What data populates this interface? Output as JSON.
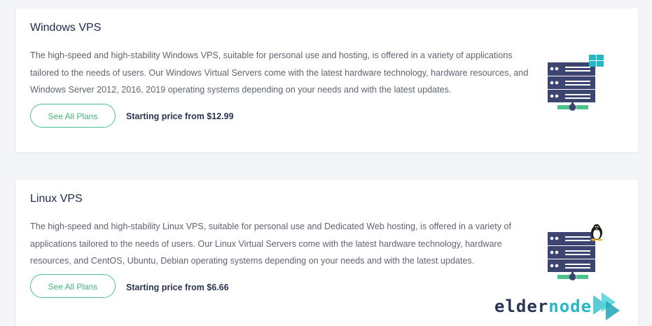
{
  "cards": [
    {
      "title": "Windows VPS",
      "description": "The high-speed and high-stability Windows VPS, suitable for personal use and hosting, is offered in a variety of applications tailored to the needs of users. Our Windows Virtual Servers come with the latest hardware technology, hardware resources, and Windows Server 2012, 2016, 2019 operating systems depending on your needs and with the latest updates.",
      "button_label": "See All Plans",
      "price": "Starting price from $12.99",
      "icon": "windows-server-icon"
    },
    {
      "title": "Linux VPS",
      "description": "The high-speed and high-stability Linux VPS, suitable for personal use and Dedicated Web hosting, is offered in a variety of applications tailored to the needs of users. Our Linux Virtual Servers come with the latest hardware technology, hardware resources, and CentOS, Ubuntu, Debian operating systems depending on your needs and with the latest updates.",
      "button_label": "See All Plans",
      "price": "Starting price from $6.66",
      "icon": "linux-server-icon"
    }
  ],
  "brand": {
    "logo_text": "eldernode",
    "colors": {
      "dark": "#2a3552",
      "accent": "#25b9c6",
      "button_green": "#4cc38a"
    }
  }
}
